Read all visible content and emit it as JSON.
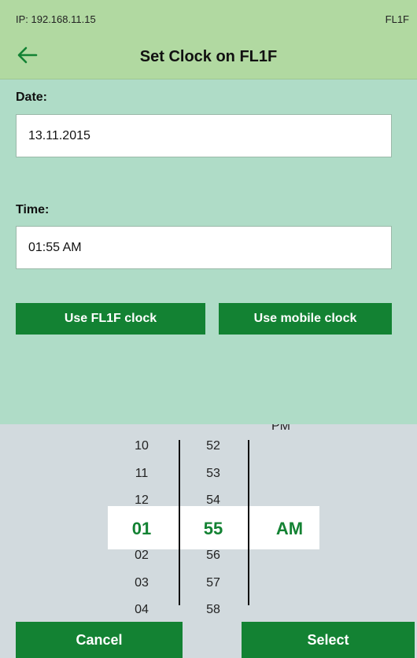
{
  "status": {
    "ip": "IP: 192.168.11.15",
    "device": "FL1F"
  },
  "header": {
    "title": "Set Clock on FL1F",
    "back_icon": "arrow-left-icon"
  },
  "form": {
    "date_label": "Date:",
    "date_value": "13.11.2015",
    "time_label": "Time:",
    "time_value": "01:55 AM",
    "use_device_clock": "Use FL1F clock",
    "use_mobile_clock": "Use mobile clock"
  },
  "picker": {
    "hours_above": [
      "10",
      "11",
      "12"
    ],
    "hour_selected": "01",
    "hours_below": [
      "02",
      "03",
      "04"
    ],
    "minutes_above": [
      "52",
      "53",
      "54"
    ],
    "minute_selected": "55",
    "minutes_below": [
      "56",
      "57",
      "58"
    ],
    "period_above": "PM",
    "period_selected": "AM"
  },
  "actions": {
    "cancel": "Cancel",
    "select": "Select"
  },
  "colors": {
    "header": "#b1d9a1",
    "content": "#afdcc7",
    "accent": "#138233",
    "picker_bg": "#d2dade"
  }
}
